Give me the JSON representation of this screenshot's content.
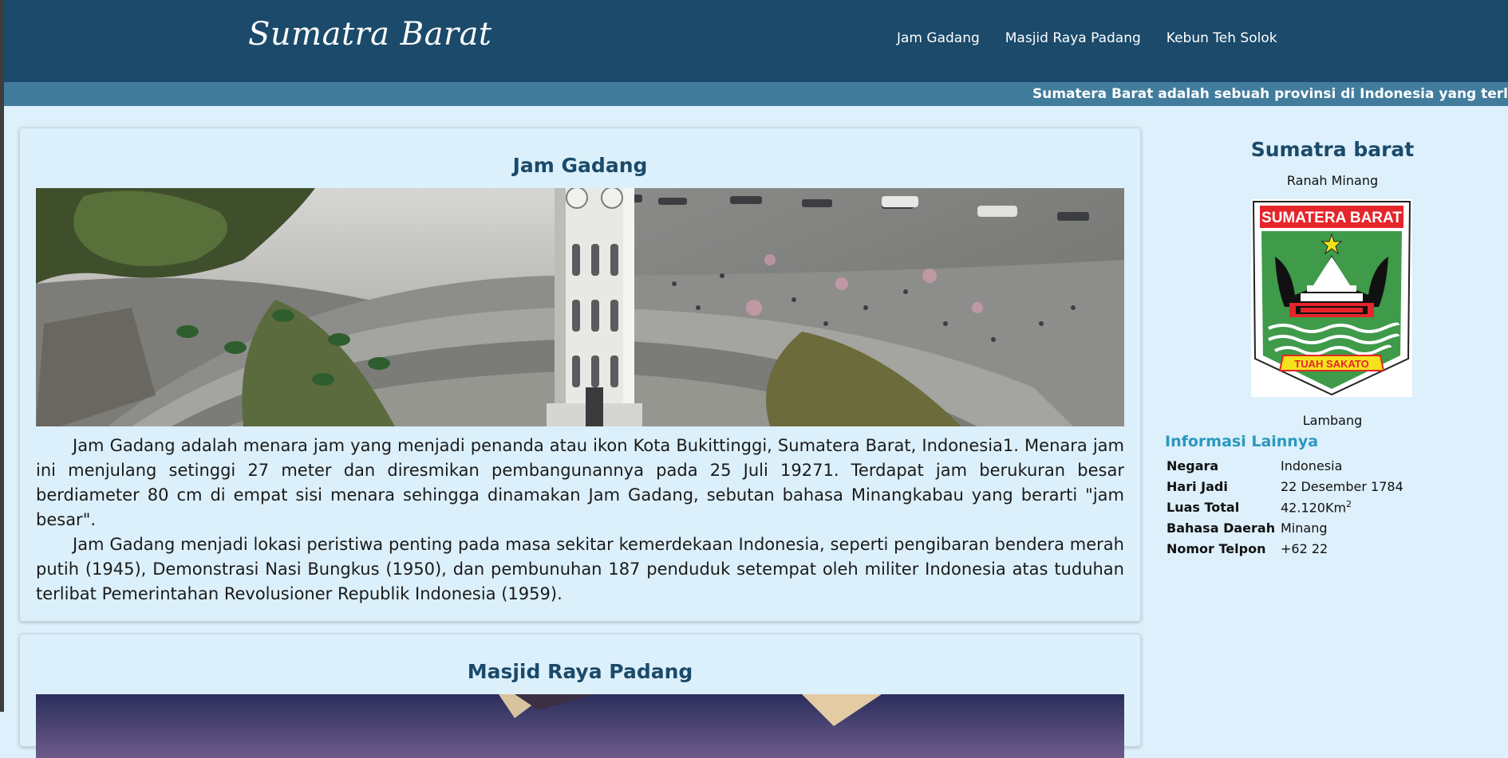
{
  "navbar": {
    "brand": "Sumatra Barat",
    "links": [
      "Jam Gadang",
      "Masjid Raya Padang",
      "Kebun Teh Solok"
    ]
  },
  "ticker": {
    "text": "Sumatera Barat adalah sebuah provinsi di Indonesia yang terletak di Pulau Sumatra"
  },
  "articles": [
    {
      "title": "Jam Gadang",
      "paragraphs": [
        "Jam Gadang adalah menara jam yang menjadi penanda atau ikon Kota Bukittinggi, Sumatera Barat, Indonesia1. Menara jam ini menjulang setinggi 27 meter dan diresmikan pembangunannya pada 25 Juli 19271. Terdapat jam berukuran besar berdiameter 80 cm di empat sisi menara sehingga dinamakan Jam Gadang, sebutan bahasa Minangkabau yang berarti \"jam besar\".",
        "Jam Gadang menjadi lokasi peristiwa penting pada masa sekitar kemerdekaan Indonesia, seperti pengibaran bendera merah putih (1945), Demonstrasi Nasi Bungkus (1950), dan pembunuhan 187 penduduk setempat oleh militer Indonesia atas tuduhan terlibat Pemerintahan Revolusioner Republik Indonesia (1959)."
      ]
    },
    {
      "title": "Masjid Raya Padang"
    }
  ],
  "sidebar": {
    "title": "Sumatra barat",
    "subtitle": "Ranah Minang",
    "emblem_top_text": "SUMATERA BARAT",
    "emblem_ribbon_text": "TUAH SAKATO",
    "emblem_caption": "Lambang",
    "info_heading": "Informasi Lainnya",
    "info": [
      {
        "key": "Negara",
        "value": "Indonesia"
      },
      {
        "key": "Hari Jadi",
        "value": "22 Desember 1784"
      },
      {
        "key": "Luas Total",
        "value": "42.120Km",
        "sup": "2"
      },
      {
        "key": "Bahasa Daerah",
        "value": "Minang"
      },
      {
        "key": "Nomor Telpon",
        "value": "+62 22"
      }
    ]
  },
  "colors": {
    "navbar": "#1b4a6a",
    "ticker": "#427c9d",
    "page_background": "#ddf0fb",
    "title_text": "#1b4a6a",
    "info_heading": "#2a98c0"
  }
}
